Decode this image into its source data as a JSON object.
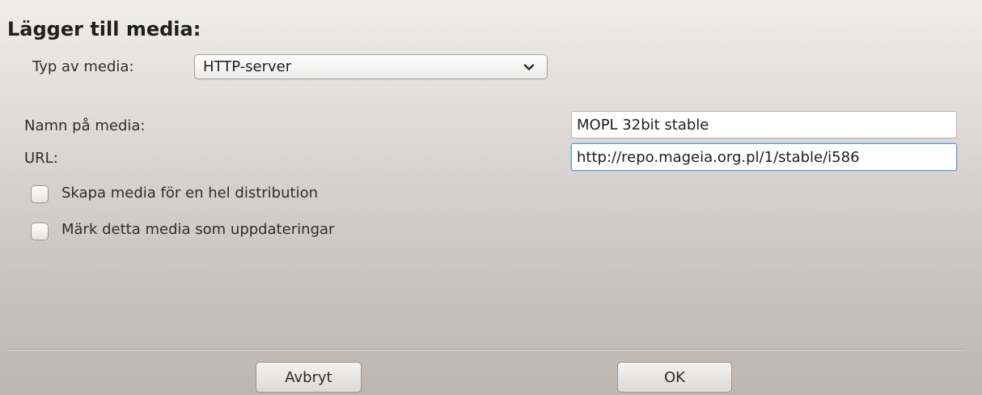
{
  "dialog": {
    "title": "Lägger till media:"
  },
  "media_type": {
    "label": "Typ av media:",
    "selected": "HTTP-server"
  },
  "media_name": {
    "label": "Namn på media:",
    "value": "MOPL 32bit stable"
  },
  "url": {
    "label": "URL:",
    "value": "http://repo.mageia.org.pl/1/stable/i586"
  },
  "options": {
    "full_distribution": {
      "label": "Skapa media för en hel distribution",
      "checked": false
    },
    "mark_as_updates": {
      "label": "Märk detta media som uppdateringar",
      "checked": false
    }
  },
  "buttons": {
    "cancel": "Avbryt",
    "ok": "OK"
  },
  "icons": {
    "dropdown": "chevron-down-icon"
  },
  "colors": {
    "focus_border": "#6a9ad0"
  }
}
